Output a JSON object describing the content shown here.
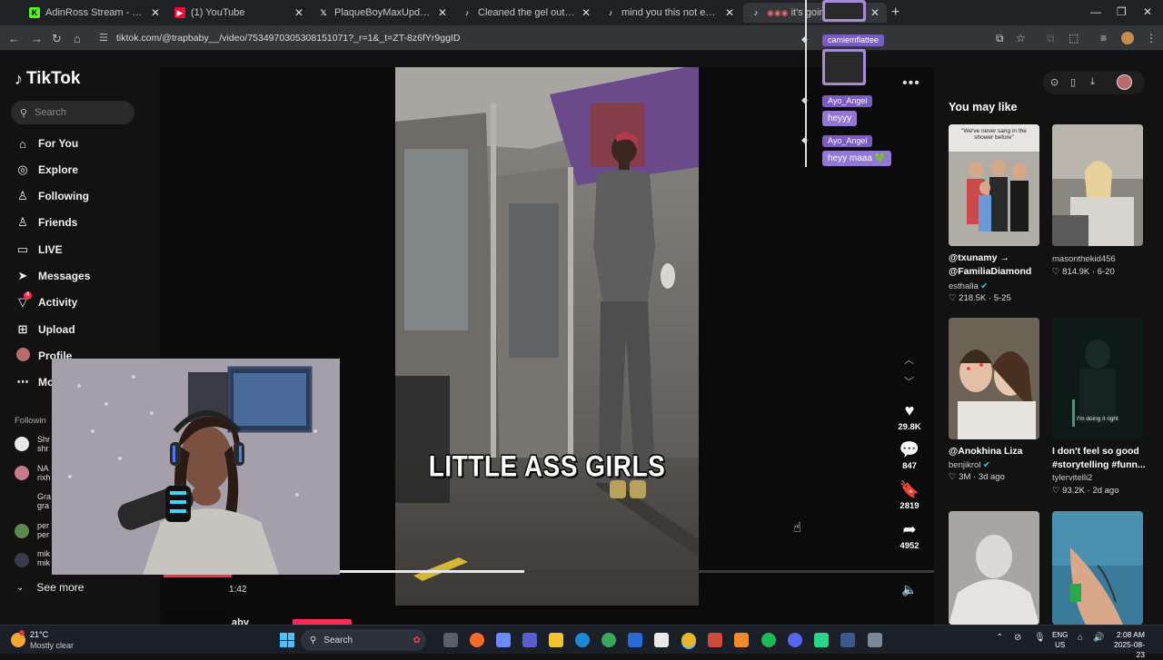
{
  "browser": {
    "tabs": [
      {
        "title": "AdinRoss Stream - Watch Live o",
        "favicon": "kick-icon",
        "color": "#53fc18"
      },
      {
        "title": "(1) YouTube",
        "favicon": "youtube-icon",
        "color": "#ff0033"
      },
      {
        "title": "PlaqueBoyMaxUpdates on X: \"",
        "favicon": "x-icon",
        "color": "#000000"
      },
      {
        "title": "Cleaned the gel out her brush t",
        "favicon": "tiktok-icon",
        "color": "#000000"
      },
      {
        "title": "mind you this not even my ma",
        "favicon": "tiktok-icon",
        "color": "#000000"
      },
      {
        "title": "it's goin",
        "favicon": "tiktok-icon",
        "color": "#000000"
      }
    ],
    "url": "tiktok.com/@trapbaby__/video/7534970305308151071?_r=1&_t=ZT-8z6fYr9ggID"
  },
  "sidebar": {
    "logo": "TikTok",
    "search_placeholder": "Search",
    "nav": [
      {
        "label": "For You",
        "icon": "home-icon",
        "glyph": "⌂"
      },
      {
        "label": "Explore",
        "icon": "compass-icon",
        "glyph": "◎"
      },
      {
        "label": "Following",
        "icon": "person-icon",
        "glyph": "♙"
      },
      {
        "label": "Friends",
        "icon": "friends-icon",
        "glyph": "♙"
      },
      {
        "label": "LIVE",
        "icon": "live-icon",
        "glyph": "▭"
      },
      {
        "label": "Messages",
        "icon": "paper-plane-icon",
        "glyph": "➤"
      },
      {
        "label": "Activity",
        "icon": "inbox-icon",
        "glyph": "▽"
      },
      {
        "label": "Upload",
        "icon": "upload-icon",
        "glyph": "⊞"
      },
      {
        "label": "Profile",
        "icon": "profile-icon",
        "glyph": "●"
      },
      {
        "label": "Mo",
        "icon": "more-icon",
        "glyph": "⋯"
      }
    ],
    "activity_badge": "4",
    "following_heading": "Followin",
    "following": [
      {
        "line1": "Shr",
        "line2": "shr"
      },
      {
        "line1": "NA",
        "line2": "rixh"
      },
      {
        "line1": "Gra",
        "line2": "gra"
      },
      {
        "line1": "per",
        "line2": "per"
      },
      {
        "line1": "mik",
        "line2": "mik"
      }
    ],
    "see_more": "See more"
  },
  "video": {
    "subtitle": "LITTLE ASS GIRLS",
    "timecode": "1:42",
    "progress": 0.31,
    "likes": "29.8K",
    "comments": "847",
    "saves": "2819",
    "shares": "4952",
    "author_partial": "aby"
  },
  "chat": [
    {
      "type": "image"
    },
    {
      "type": "name",
      "text": "camiemflattee"
    },
    {
      "type": "image"
    },
    {
      "type": "name",
      "text": "Ayo_Angel"
    },
    {
      "type": "msg",
      "text": "heyyy"
    },
    {
      "type": "name",
      "text": "Ayo_Angel"
    },
    {
      "type": "msg",
      "text": "heyy maaa 💚"
    }
  ],
  "recommendations": {
    "heading": "You may like",
    "items": [
      {
        "title": "@txunamy → @FamiliaDiamond",
        "author": "esthalla",
        "verified": true,
        "likes": "218.5K",
        "date": "5-25",
        "caption": "\"We've never sang in the shower before\""
      },
      {
        "title": "",
        "author": "masonthekid456",
        "verified": false,
        "likes": "814.9K",
        "date": "6-20",
        "caption": ""
      },
      {
        "title": "@Anokhina Liza",
        "author": "benjikrol",
        "verified": true,
        "likes": "3M",
        "date": "3d ago",
        "caption": ""
      },
      {
        "title": "I don't feel so good #storytelling #funn...",
        "author": "tylervitelli2",
        "verified": false,
        "likes": "93.2K",
        "date": "2d ago",
        "caption": "I'm doing it right"
      },
      {
        "title": "",
        "author": "",
        "verified": false,
        "likes": "",
        "date": "",
        "caption": ""
      },
      {
        "title": "",
        "author": "",
        "verified": false,
        "likes": "",
        "date": "",
        "caption": ""
      }
    ]
  },
  "taskbar": {
    "temp": "21°C",
    "weather": "Mostly clear",
    "search": "Search",
    "lang1": "ENG",
    "lang2": "US",
    "time": "2:08 AM",
    "date": "2025-08-23"
  }
}
